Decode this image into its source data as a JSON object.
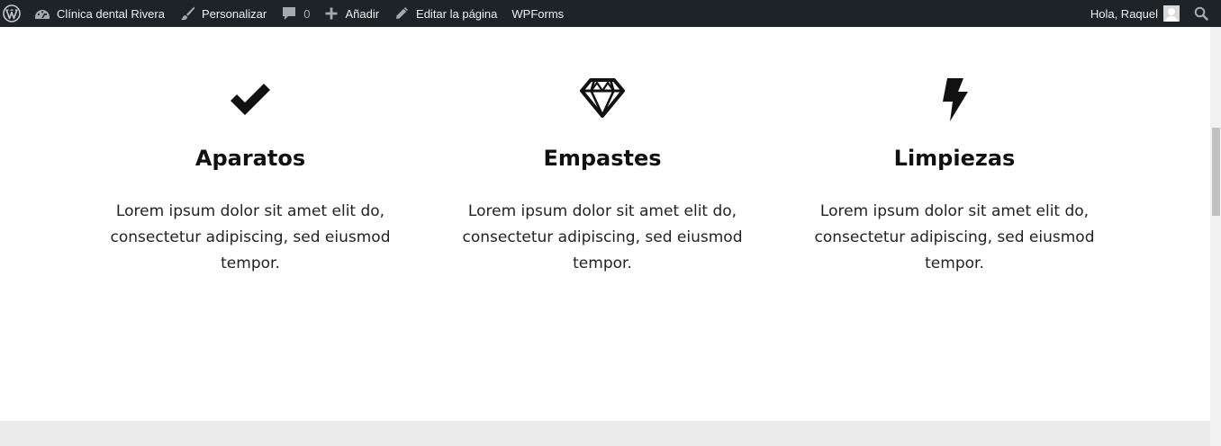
{
  "adminbar": {
    "site_name": "Clínica dental Rivera",
    "customize": "Personalizar",
    "comments_count": "0",
    "new": "Añadir",
    "edit_page": "Editar la página",
    "wpforms": "WPForms",
    "greeting": "Hola, Raquel",
    "icons": [
      "wordpress-icon",
      "dashboard-icon",
      "brush-icon",
      "comment-icon",
      "plus-icon",
      "pencil-icon",
      "avatar",
      "search-icon"
    ]
  },
  "services": [
    {
      "icon": "checkmark-icon",
      "title": "Aparatos",
      "description": "Lorem ipsum dolor sit amet elit do, consectetur adipiscing, sed eiusmod tempor."
    },
    {
      "icon": "diamond-icon",
      "title": "Empastes",
      "description": "Lorem ipsum dolor sit amet elit do, consectetur adipiscing, sed eiusmod tempor."
    },
    {
      "icon": "lightning-icon",
      "title": "Limpiezas",
      "description": "Lorem ipsum dolor sit amet elit do, consectetur adipiscing, sed eiusmod tempor."
    }
  ],
  "colors": {
    "adminbar_bg": "#1d2327",
    "adminbar_text": "#f0f0f1",
    "heading": "#111111",
    "body_text": "#222222",
    "next_section_bg": "#ececec"
  }
}
